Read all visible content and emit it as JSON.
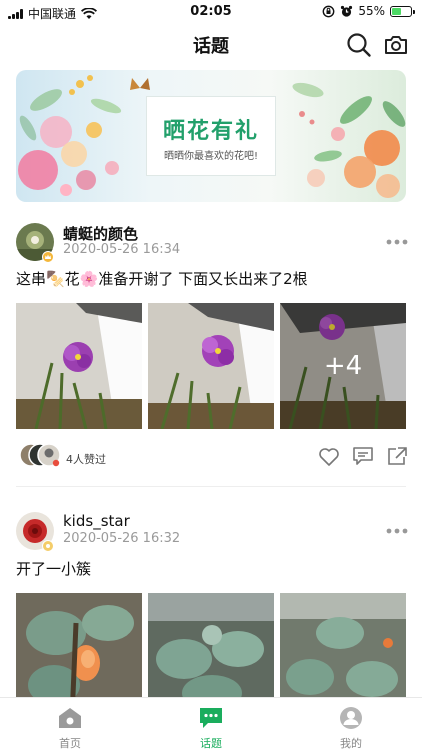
{
  "status_bar": {
    "carrier": "中国联通",
    "time": "02:05",
    "battery": "55%",
    "battery_level": 0.55
  },
  "nav": {
    "title": "话题"
  },
  "banner": {
    "headline": "晒花有礼",
    "subtitle": "晒晒你最喜欢的花吧!"
  },
  "posts": [
    {
      "user": "蜻蜓的颜色",
      "date": "2020-05-26 16:34",
      "text": "这串🍢花🌸准备开谢了  下面又长出来了2根",
      "more_count": "+4",
      "likes_text": "4人赞过"
    },
    {
      "user": "kids_star",
      "date": "2020-05-26 16:32",
      "text": "开了一小簇"
    }
  ],
  "tabs": [
    {
      "label": "首页",
      "icon": "home-icon"
    },
    {
      "label": "话题",
      "icon": "chat-bubble-icon"
    },
    {
      "label": "我的",
      "icon": "person-icon"
    }
  ],
  "colors": {
    "accent": "#1aad5d",
    "banner_text": "#22a06b"
  }
}
